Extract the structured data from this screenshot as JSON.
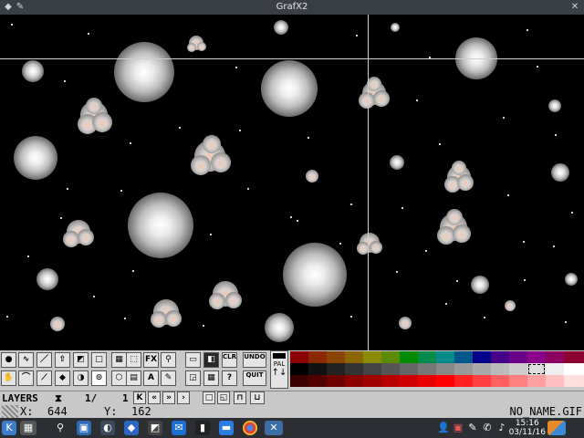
{
  "window": {
    "title": "GrafX2"
  },
  "toolbar": {
    "effects_label": "FX",
    "text_label": "A",
    "clear_label": "CLR",
    "undo_label": "UNDO",
    "redo_label": "→",
    "quit_label": "QUIT",
    "help_label": "?",
    "pal_label": "PAL",
    "brush_sym": "⊙"
  },
  "layers": {
    "label": "LAYERS",
    "current": "1/",
    "count": "1"
  },
  "status": {
    "x_label": "X:",
    "x_value": "644",
    "y_label": "Y:",
    "y_value": "162",
    "filename": "NO_NAME.GIF"
  },
  "taskbar": {
    "time": "15:16",
    "date": "03/11/16"
  },
  "colors": {
    "window_title_bg": "#3a3f46",
    "canvas_bg": "#000000",
    "toolbar_bg": "#c8c8c8",
    "taskbar_bg": "#2b2e33"
  }
}
